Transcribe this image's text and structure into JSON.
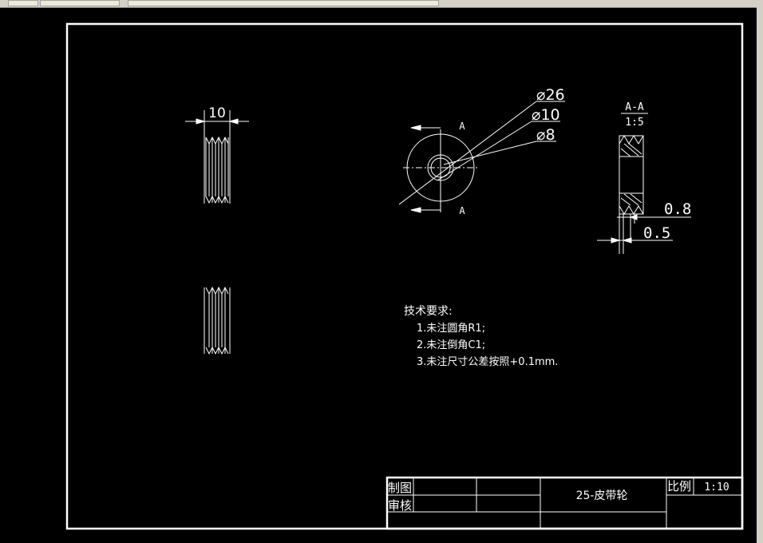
{
  "views": {
    "front_top_dim": "10",
    "section_label_top": "A",
    "section_label_bottom": "A",
    "dia_outer": "⌀26",
    "dia_mid": "⌀10",
    "dia_inner": "⌀8",
    "section_title": "A-A",
    "section_scale": "1:5",
    "dim_groove": "0.8",
    "dim_offset": "0.5"
  },
  "notes": {
    "heading": "技术要求:",
    "items": [
      "1.未注圆角R1;",
      "2.未注倒角C1;",
      "3.未注尺寸公差按照+0.1mm."
    ]
  },
  "title_block": {
    "drawn_by": "制图",
    "checked_by": "审核",
    "part_name": "25-皮带轮",
    "scale_label": "比例",
    "scale_value": "1:10"
  }
}
